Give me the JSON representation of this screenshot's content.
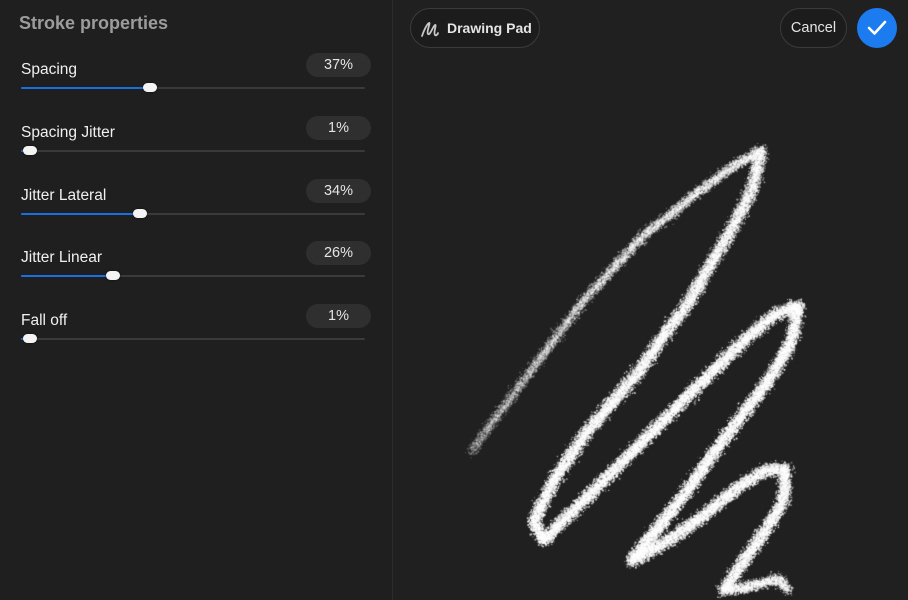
{
  "panel": {
    "title": "Stroke properties",
    "sliders": [
      {
        "label": "Spacing",
        "value_text": "37%",
        "value": 0.37
      },
      {
        "label": "Spacing Jitter",
        "value_text": "1%",
        "value": 0.01
      },
      {
        "label": "Jitter Lateral",
        "value_text": "34%",
        "value": 0.34
      },
      {
        "label": "Jitter Linear",
        "value_text": "26%",
        "value": 0.26
      },
      {
        "label": "Fall off",
        "value_text": "1%",
        "value": 0.01
      }
    ]
  },
  "toolbar": {
    "pad_label": "Drawing Pad",
    "pad_icon": "scribble-icon",
    "cancel_label": "Cancel",
    "confirm_icon": "checkmark-icon"
  },
  "colors": {
    "accent": "#1d7bf0",
    "slider_fill": "#1a6fe0",
    "background": "#1e1e1e",
    "stroke": "#ffffff"
  }
}
